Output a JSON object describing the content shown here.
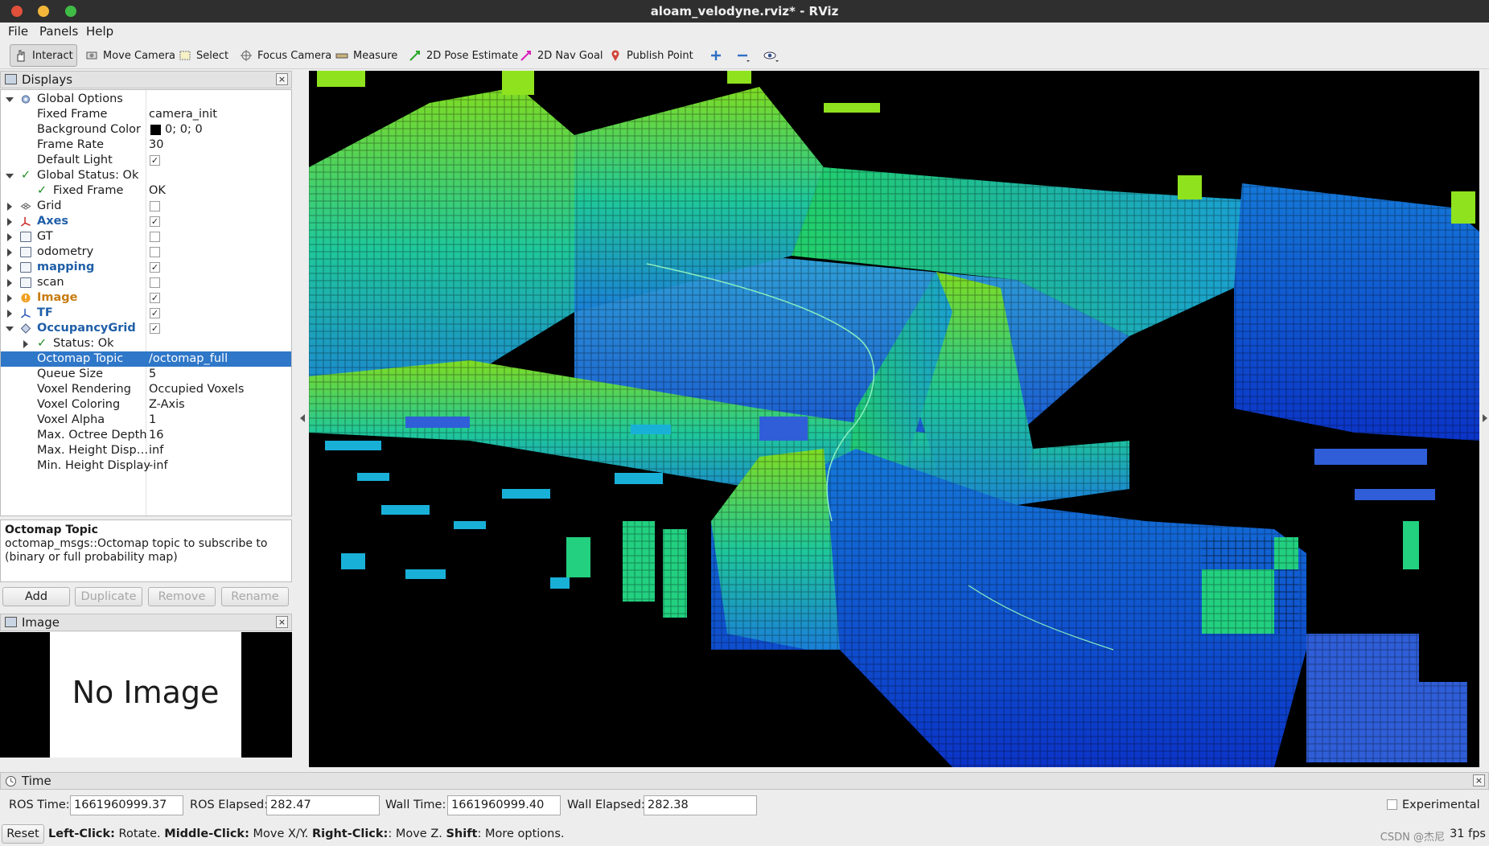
{
  "window": {
    "title": "aloam_velodyne.rviz* - RViz"
  },
  "menu": {
    "file": "File",
    "panels": "Panels",
    "help": "Help"
  },
  "toolbar": {
    "interact": "Interact",
    "move_camera": "Move Camera",
    "select": "Select",
    "focus_camera": "Focus Camera",
    "measure": "Measure",
    "pose_estimate": "2D Pose Estimate",
    "nav_goal": "2D Nav Goal",
    "publish_point": "Publish Point"
  },
  "displays": {
    "title": "Displays",
    "rows": [
      {
        "name": "Global Options",
        "value": ""
      },
      {
        "name": "Fixed Frame",
        "value": "camera_init"
      },
      {
        "name": "Background Color",
        "value": "0; 0; 0"
      },
      {
        "name": "Frame Rate",
        "value": "30"
      },
      {
        "name": "Default Light",
        "value": "✓"
      },
      {
        "name": "Global Status: Ok",
        "value": ""
      },
      {
        "name": "Fixed Frame",
        "value": "OK"
      },
      {
        "name": "Grid",
        "value": ""
      },
      {
        "name": "Axes",
        "value": "✓"
      },
      {
        "name": "GT",
        "value": ""
      },
      {
        "name": "odometry",
        "value": ""
      },
      {
        "name": "mapping",
        "value": "✓"
      },
      {
        "name": "scan",
        "value": ""
      },
      {
        "name": "Image",
        "value": "✓"
      },
      {
        "name": "TF",
        "value": "✓"
      },
      {
        "name": "OccupancyGrid",
        "value": "✓"
      },
      {
        "name": "Status: Ok",
        "value": ""
      },
      {
        "name": "Octomap Topic",
        "value": "/octomap_full"
      },
      {
        "name": "Queue Size",
        "value": "5"
      },
      {
        "name": "Voxel Rendering",
        "value": "Occupied Voxels"
      },
      {
        "name": "Voxel Coloring",
        "value": "Z-Axis"
      },
      {
        "name": "Voxel Alpha",
        "value": "1"
      },
      {
        "name": "Max. Octree Depth",
        "value": "16"
      },
      {
        "name": "Max. Height Disp…",
        "value": "inf"
      },
      {
        "name": "Min. Height Display",
        "value": "-inf"
      }
    ],
    "description_title": "Octomap Topic",
    "description_text": "octomap_msgs::Octomap topic to subscribe to (binary or full probability map)",
    "buttons": {
      "add": "Add",
      "duplicate": "Duplicate",
      "remove": "Remove",
      "rename": "Rename"
    }
  },
  "image_panel": {
    "title": "Image",
    "placeholder": "No Image"
  },
  "time": {
    "title": "Time",
    "ros_time_label": "ROS Time:",
    "ros_time": "1661960999.37",
    "ros_elapsed_label": "ROS Elapsed:",
    "ros_elapsed": "282.47",
    "wall_time_label": "Wall Time:",
    "wall_time": "1661960999.40",
    "wall_elapsed_label": "Wall Elapsed:",
    "wall_elapsed": "282.38",
    "experimental": "Experimental"
  },
  "status": {
    "reset": "Reset",
    "left_click": "Left-Click:",
    "left_action": " Rotate. ",
    "middle_click": "Middle-Click:",
    "middle_action": " Move X/Y. ",
    "right_click": "Right-Click:",
    "right_action": ": Move Z. ",
    "shift": "Shift",
    "shift_action": ": More options.",
    "fps": "31 fps",
    "watermark": "CSDN @杰尼"
  },
  "colors": {
    "selection": "#2f77c8",
    "viewport_bg": "#000000",
    "voxel_low": "#0a3fd6",
    "voxel_mid": "#17c0c8",
    "voxel_high": "#8fe21e"
  }
}
